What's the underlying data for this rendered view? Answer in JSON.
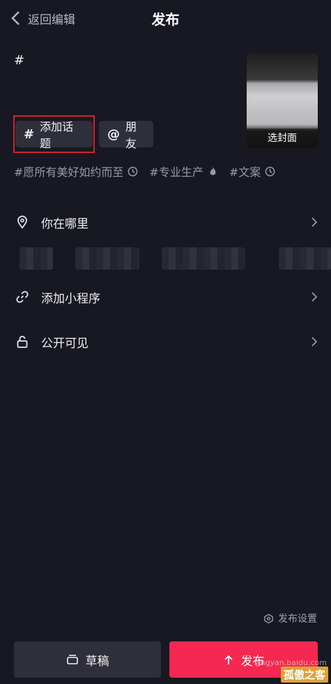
{
  "header": {
    "back_label": "返回编辑",
    "title": "发布"
  },
  "editor": {
    "caption": "#"
  },
  "cover": {
    "label": "选封面"
  },
  "chips": {
    "topic_symbol": "#",
    "topic_label": "添加话题",
    "friends_symbol": "@",
    "friends_label": "朋友"
  },
  "suggested_tags": [
    {
      "text": "#愿所有美好如约而至",
      "icon": "clock-icon"
    },
    {
      "text": "#专业生产",
      "icon": "fire-icon"
    },
    {
      "text": "#文案",
      "icon": "clock-icon"
    }
  ],
  "rows": {
    "location": {
      "label": "你在哪里",
      "icon": "location-pin-icon"
    },
    "mini_program": {
      "label": "添加小程序",
      "icon": "link-icon"
    },
    "visibility": {
      "label": "公开可见",
      "icon": "unlock-icon"
    }
  },
  "footer": {
    "settings_label": "发布设置",
    "draft_label": "草稿",
    "publish_label": "发布"
  },
  "watermark": {
    "text": "jingyan.baidu.com",
    "brand": "孤傲之客"
  },
  "colors": {
    "background": "#171822",
    "chip": "#2e2f3a",
    "accent": "#f42850",
    "highlight_frame": "#d4222c"
  }
}
